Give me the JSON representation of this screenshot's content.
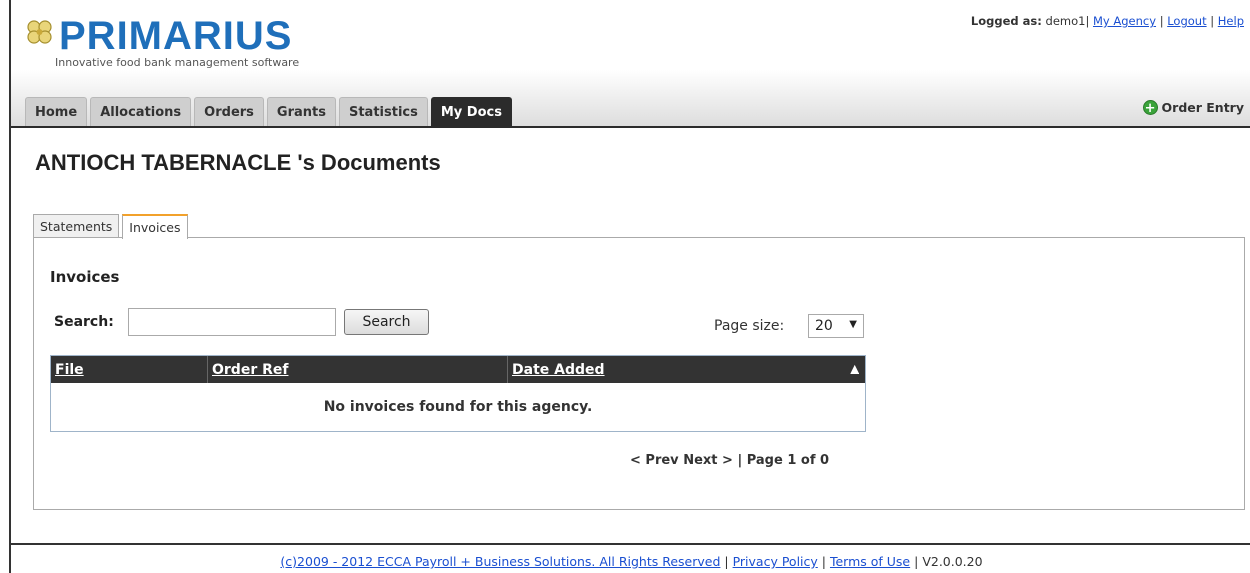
{
  "header": {
    "brand": "PRIMARIUS",
    "tagline": "Innovative food bank management software",
    "logged_as_label": "Logged as:",
    "username": "demo1",
    "separator": "|",
    "links": {
      "my_agency": "My Agency",
      "logout": "Logout",
      "help": "Help"
    },
    "order_entry": "Order Entry"
  },
  "nav": {
    "tabs": [
      {
        "label": "Home",
        "active": false
      },
      {
        "label": "Allocations",
        "active": false
      },
      {
        "label": "Orders",
        "active": false
      },
      {
        "label": "Grants",
        "active": false
      },
      {
        "label": "Statistics",
        "active": false
      },
      {
        "label": "My Docs",
        "active": true
      }
    ]
  },
  "main": {
    "title": "ANTIOCH TABERNACLE 's Documents",
    "tabs": [
      {
        "label": "Statements",
        "active": false
      },
      {
        "label": "Invoices",
        "active": true
      }
    ],
    "panel": {
      "title": "Invoices",
      "search_label": "Search:",
      "search_value": "",
      "search_button": "Search",
      "page_size_label": "Page size:",
      "page_size_value": "20",
      "columns": [
        "File",
        "Order Ref",
        "Date Added"
      ],
      "empty_message": "No invoices found for this agency.",
      "pager": {
        "prev": "< Prev",
        "next": "Next >",
        "separator": "|",
        "page_info": "Page 1 of 0"
      }
    }
  },
  "footer": {
    "copyright": "(c)2009 - 2012 ECCA Payroll + Business Solutions. All Rights Reserved",
    "privacy": "Privacy Policy",
    "terms": "Terms of Use",
    "version": "V2.0.0.20",
    "separator": "|"
  },
  "colors": {
    "brand": "#1f6fba",
    "nav_active": "#2b2b2b",
    "tab_accent": "#f2a12b",
    "link": "#1a4fd1"
  }
}
